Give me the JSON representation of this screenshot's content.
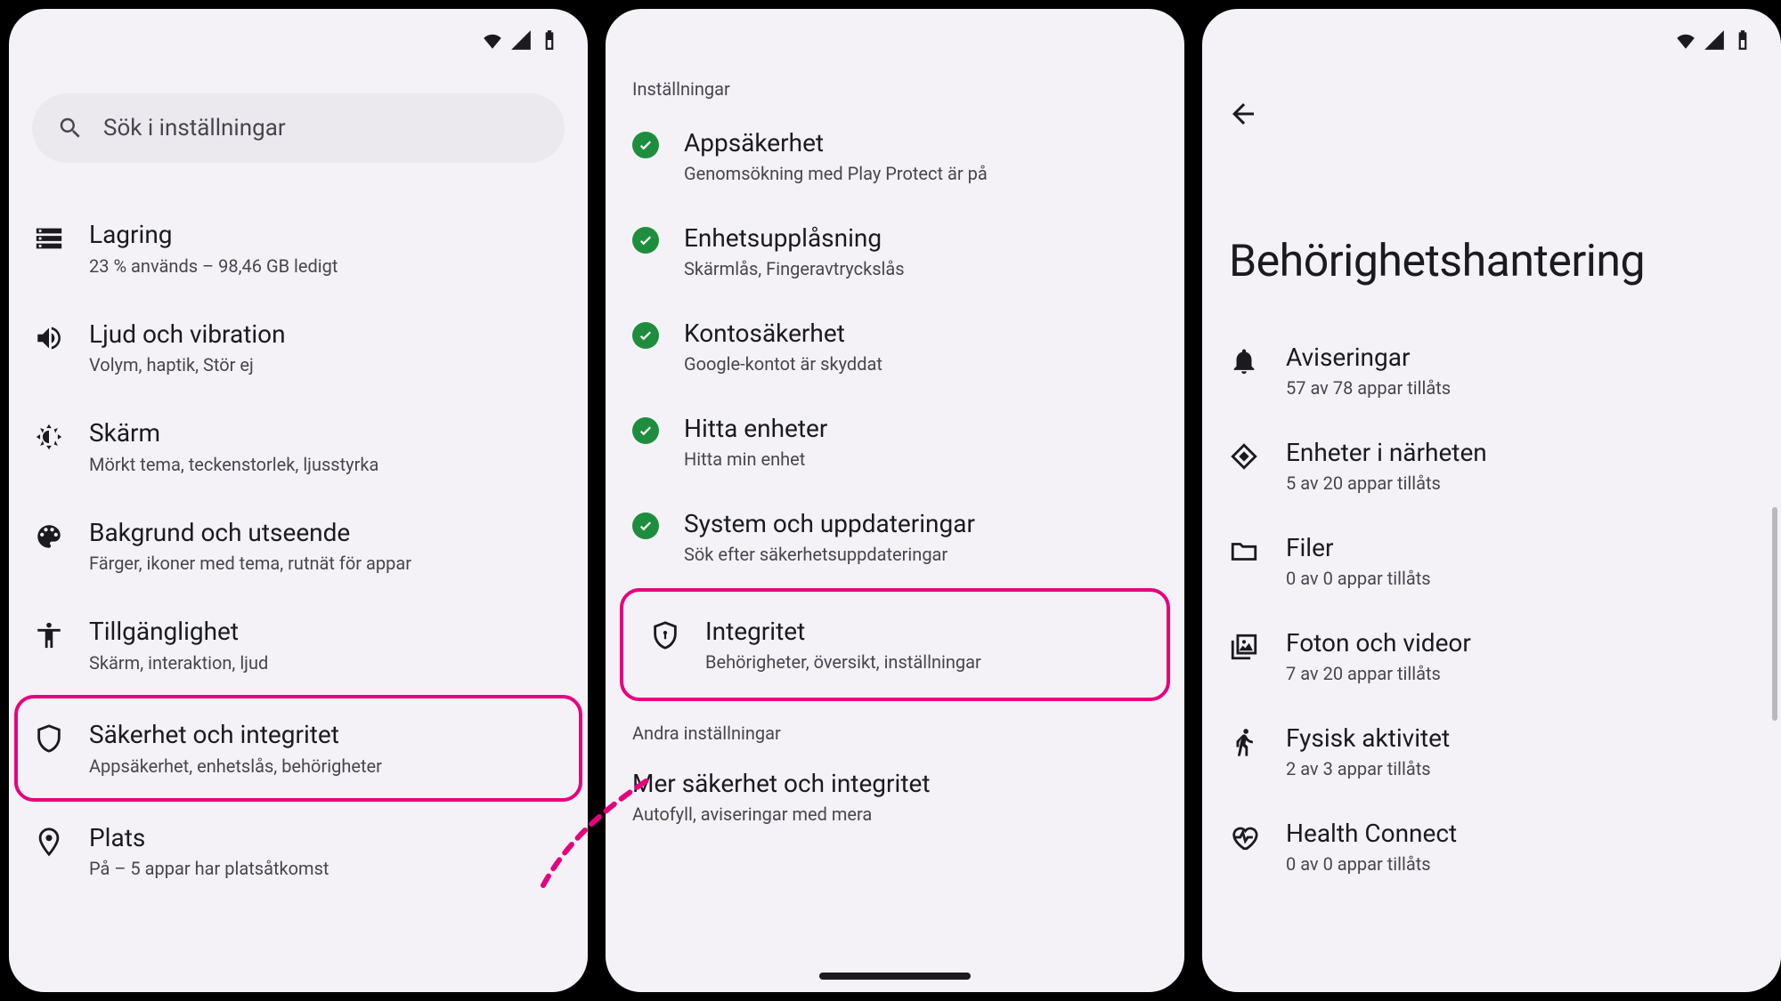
{
  "highlight_color": "#e6007e",
  "accent_green": "#1e8e3e",
  "screen1": {
    "search_placeholder": "Sök i inställningar",
    "items": [
      {
        "icon": "storage",
        "title": "Lagring",
        "sub": "23 % används – 98,46 GB ledigt"
      },
      {
        "icon": "sound",
        "title": "Ljud och vibration",
        "sub": "Volym, haptik, Stör ej"
      },
      {
        "icon": "display",
        "title": "Skärm",
        "sub": "Mörkt tema, teckenstorlek, ljusstyrka"
      },
      {
        "icon": "palette",
        "title": "Bakgrund och utseende",
        "sub": "Färger, ikoner med tema, rutnät för appar"
      },
      {
        "icon": "accessibility",
        "title": "Tillgänglighet",
        "sub": "Skärm, interaktion, ljud"
      },
      {
        "icon": "shield",
        "title": "Säkerhet och integritet",
        "sub": "Appsäkerhet, enhetslås, behörigheter",
        "highlight": true
      },
      {
        "icon": "location",
        "title": "Plats",
        "sub": "På – 5 appar har platsåtkomst"
      }
    ]
  },
  "screen2": {
    "header": "Inställningar",
    "items": [
      {
        "title": "Appsäkerhet",
        "sub": "Genomsökning med Play Protect är på"
      },
      {
        "title": "Enhetsupplåsning",
        "sub": "Skärmlås, Fingeravtryckslås"
      },
      {
        "title": "Kontosäkerhet",
        "sub": "Google-kontot är skyddat"
      },
      {
        "title": "Hitta enheter",
        "sub": "Hitta min enhet"
      },
      {
        "title": "System och uppdateringar",
        "sub": "Sök efter säkerhetsuppdateringar"
      }
    ],
    "privacy": {
      "title": "Integritet",
      "sub": "Behörigheter, översikt, inställningar"
    },
    "other_header": "Andra inställningar",
    "more": {
      "title": "Mer säkerhet och integritet",
      "sub": "Autofyll, aviseringar med mera"
    }
  },
  "screen3": {
    "title": "Behörighetshantering",
    "items": [
      {
        "icon": "bell",
        "title": "Aviseringar",
        "sub": "57 av 78 appar tillåts"
      },
      {
        "icon": "nearby",
        "title": "Enheter i närheten",
        "sub": "5 av 20 appar tillåts"
      },
      {
        "icon": "folder",
        "title": "Filer",
        "sub": "0 av 0 appar tillåts"
      },
      {
        "icon": "photos",
        "title": "Foton och videor",
        "sub": "7 av 20 appar tillåts"
      },
      {
        "icon": "run",
        "title": "Fysisk aktivitet",
        "sub": "2 av 3 appar tillåts"
      },
      {
        "icon": "health",
        "title": "Health Connect",
        "sub": "0 av 0 appar tillåts"
      }
    ]
  }
}
